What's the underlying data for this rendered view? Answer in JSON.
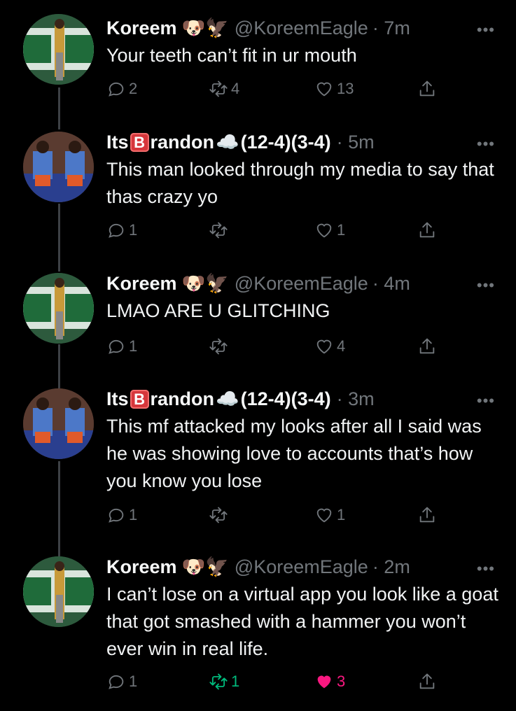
{
  "tweets": [
    {
      "author": "Koreem",
      "author_prefix": "",
      "author_suffix": "",
      "emoji": "🐶🦅",
      "handle": "@KoreemEagle",
      "time": "· 7m",
      "text": "Your teeth can’t fit in ur mouth",
      "replies": "2",
      "retweets": "4",
      "likes": "13",
      "retweeted": false,
      "liked": false
    },
    {
      "author": "Its",
      "author_box": "B",
      "author_suffix": "randon",
      "emoji": "☁️",
      "record": "(12-4)(3-4)",
      "time": "· 5m",
      "text": "This man looked through my media to say that thas crazy yo",
      "replies": "1",
      "retweets": "",
      "likes": "1",
      "retweeted": false,
      "liked": false
    },
    {
      "author": "Koreem",
      "emoji": "🐶🦅",
      "handle": "@KoreemEagle",
      "time": "· 4m",
      "text": "LMAO ARE U GLITCHING",
      "replies": "1",
      "retweets": "",
      "likes": "4",
      "retweeted": false,
      "liked": false
    },
    {
      "author": "Its",
      "author_box": "B",
      "author_suffix": "randon",
      "emoji": "☁️",
      "record": "(12-4)(3-4)",
      "time": "· 3m",
      "text": "This mf attacked my looks after all I said was he was showing love to accounts that’s how you know you lose",
      "replies": "1",
      "retweets": "",
      "likes": "1",
      "retweeted": false,
      "liked": false
    },
    {
      "author": "Koreem",
      "emoji": "🐶🦅",
      "handle": "@KoreemEagle",
      "time": "· 2m",
      "text": "I can’t lose on a virtual app you look like a goat that got smashed with a hammer you won’t ever win in real life.",
      "replies": "1",
      "retweets": "1",
      "likes": "3",
      "retweeted": true,
      "liked": true
    }
  ],
  "more_glyph": "•••",
  "colors": {
    "background": "#000000",
    "muted": "#71767b",
    "retweet_active": "#00ba7c",
    "like_active": "#f91880"
  },
  "icons": {
    "reply": "reply-icon",
    "retweet": "retweet-icon",
    "like": "heart-icon",
    "share": "share-icon",
    "more": "more-icon"
  }
}
